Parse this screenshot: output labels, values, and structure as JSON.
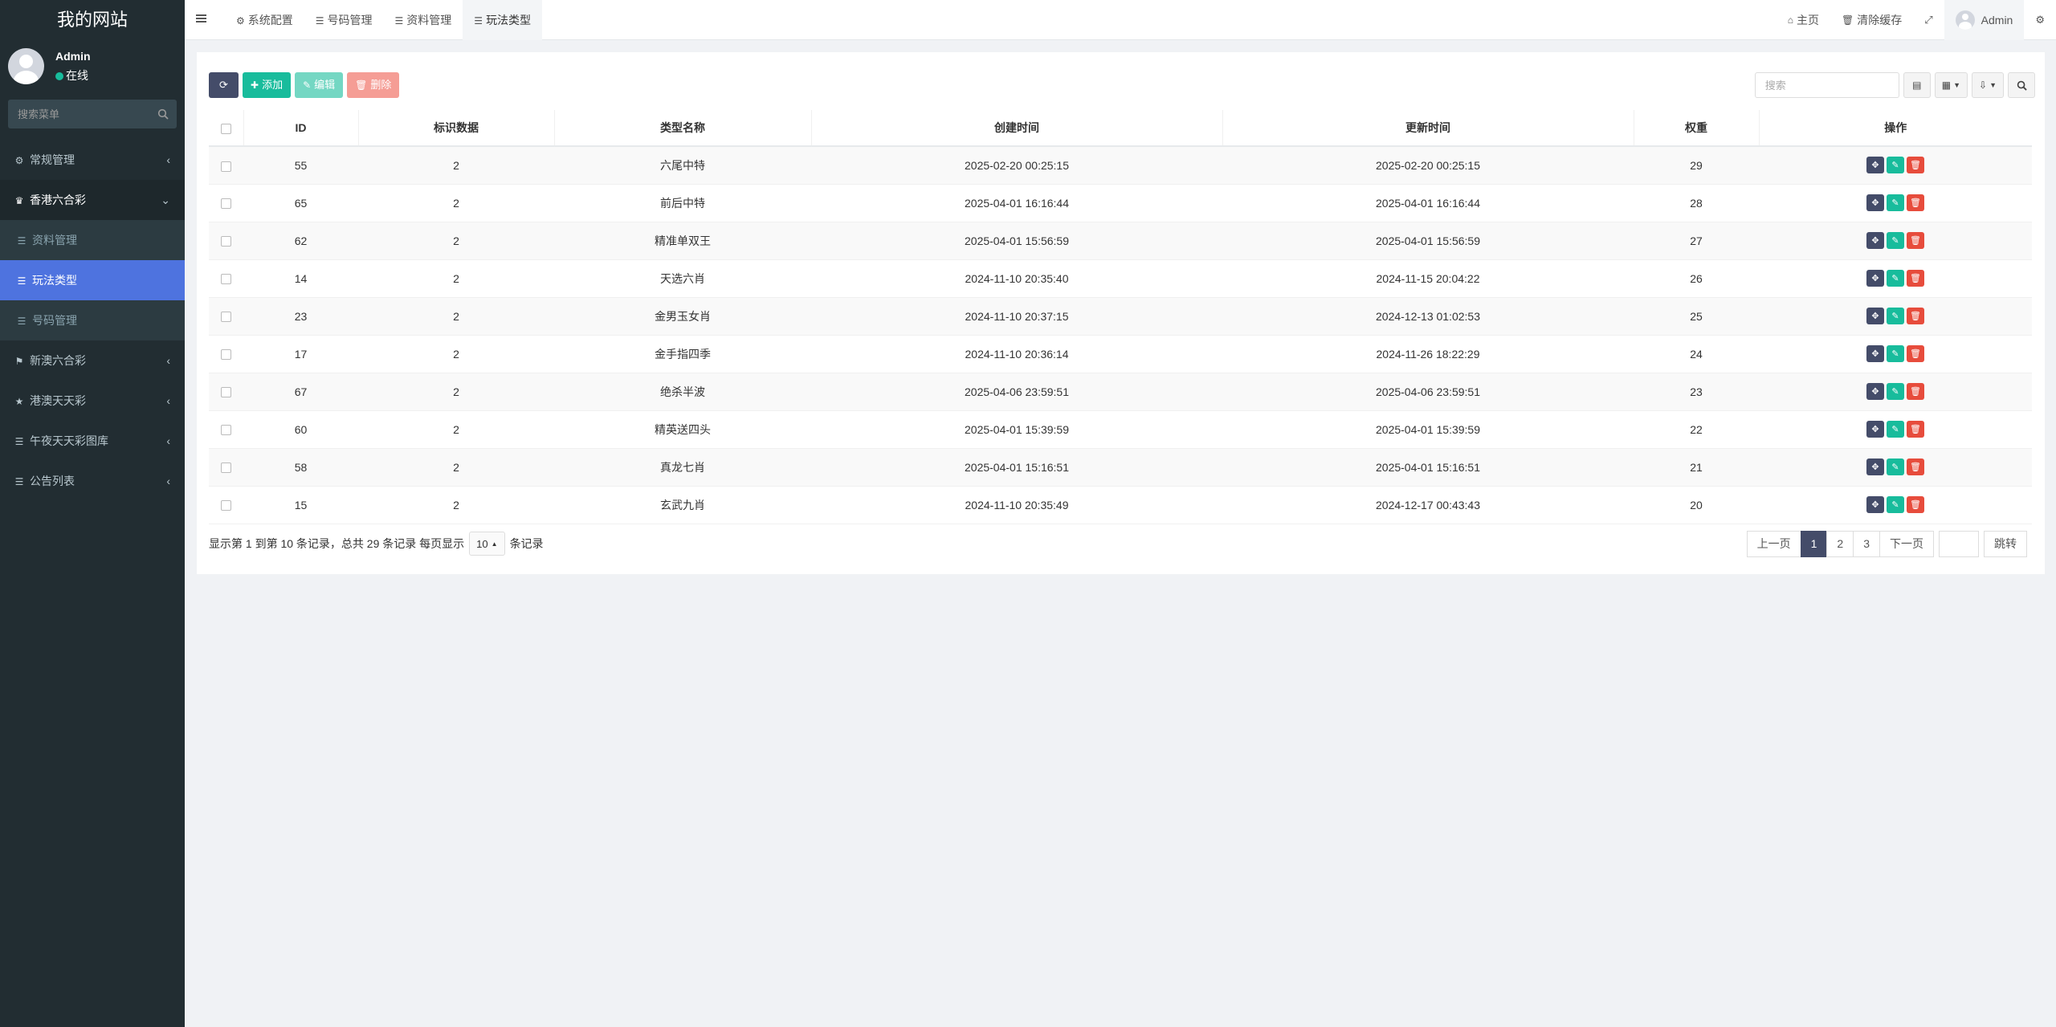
{
  "sidebar": {
    "brand": "我的网站",
    "user": {
      "name": "Admin",
      "status": "在线"
    },
    "search_placeholder": "搜索菜单",
    "menu": [
      {
        "label": "常规管理",
        "icon": "cogs-icon",
        "caret": "‹"
      },
      {
        "label": "香港六合彩",
        "icon": "trophy-icon",
        "caret": "⌄"
      },
      {
        "label": "资料管理",
        "icon": "list-icon"
      },
      {
        "label": "玩法类型",
        "icon": "list-icon"
      },
      {
        "label": "号码管理",
        "icon": "list-icon"
      },
      {
        "label": "新澳六合彩",
        "icon": "flag-icon",
        "caret": "‹"
      },
      {
        "label": "港澳天天彩",
        "icon": "star-icon",
        "caret": "‹"
      },
      {
        "label": "午夜天天彩图库",
        "icon": "list-icon",
        "caret": "‹"
      },
      {
        "label": "公告列表",
        "icon": "list-icon",
        "caret": "‹"
      }
    ]
  },
  "topbar": {
    "tabs": [
      {
        "label": "系统配置",
        "icon": "gear-icon"
      },
      {
        "label": "号码管理",
        "icon": "list-icon"
      },
      {
        "label": "资料管理",
        "icon": "list-icon"
      },
      {
        "label": "玩法类型",
        "icon": "list-icon"
      }
    ],
    "home": "主页",
    "clear_cache": "清除缓存",
    "user": "Admin"
  },
  "toolbar": {
    "add": "添加",
    "edit": "编辑",
    "delete": "删除",
    "search_placeholder": "搜索"
  },
  "table": {
    "columns": [
      "ID",
      "标识数据",
      "类型名称",
      "创建时间",
      "更新时间",
      "权重",
      "操作"
    ],
    "rows": [
      {
        "id": "55",
        "flag": "2",
        "name": "六尾中特",
        "created": "2025-02-20 00:25:15",
        "updated": "2025-02-20 00:25:15",
        "weight": "29"
      },
      {
        "id": "65",
        "flag": "2",
        "name": "前后中特",
        "created": "2025-04-01 16:16:44",
        "updated": "2025-04-01 16:16:44",
        "weight": "28"
      },
      {
        "id": "62",
        "flag": "2",
        "name": "精准单双王",
        "created": "2025-04-01 15:56:59",
        "updated": "2025-04-01 15:56:59",
        "weight": "27"
      },
      {
        "id": "14",
        "flag": "2",
        "name": "天选六肖",
        "created": "2024-11-10 20:35:40",
        "updated": "2024-11-15 20:04:22",
        "weight": "26"
      },
      {
        "id": "23",
        "flag": "2",
        "name": "金男玉女肖",
        "created": "2024-11-10 20:37:15",
        "updated": "2024-12-13 01:02:53",
        "weight": "25"
      },
      {
        "id": "17",
        "flag": "2",
        "name": "金手指四季",
        "created": "2024-11-10 20:36:14",
        "updated": "2024-11-26 18:22:29",
        "weight": "24"
      },
      {
        "id": "67",
        "flag": "2",
        "name": "绝杀半波",
        "created": "2025-04-06 23:59:51",
        "updated": "2025-04-06 23:59:51",
        "weight": "23"
      },
      {
        "id": "60",
        "flag": "2",
        "name": "精英送四头",
        "created": "2025-04-01 15:39:59",
        "updated": "2025-04-01 15:39:59",
        "weight": "22"
      },
      {
        "id": "58",
        "flag": "2",
        "name": "真龙七肖",
        "created": "2025-04-01 15:16:51",
        "updated": "2025-04-01 15:16:51",
        "weight": "21"
      },
      {
        "id": "15",
        "flag": "2",
        "name": "玄武九肖",
        "created": "2024-11-10 20:35:49",
        "updated": "2024-12-17 00:43:43",
        "weight": "20"
      }
    ]
  },
  "footer": {
    "info_prefix": "显示第 1 到第 10 条记录，总共 29 条记录 每页显示",
    "page_size": "10",
    "info_suffix": "条记录",
    "prev": "上一页",
    "pages": [
      "1",
      "2",
      "3"
    ],
    "next": "下一页",
    "jump": "跳转"
  }
}
